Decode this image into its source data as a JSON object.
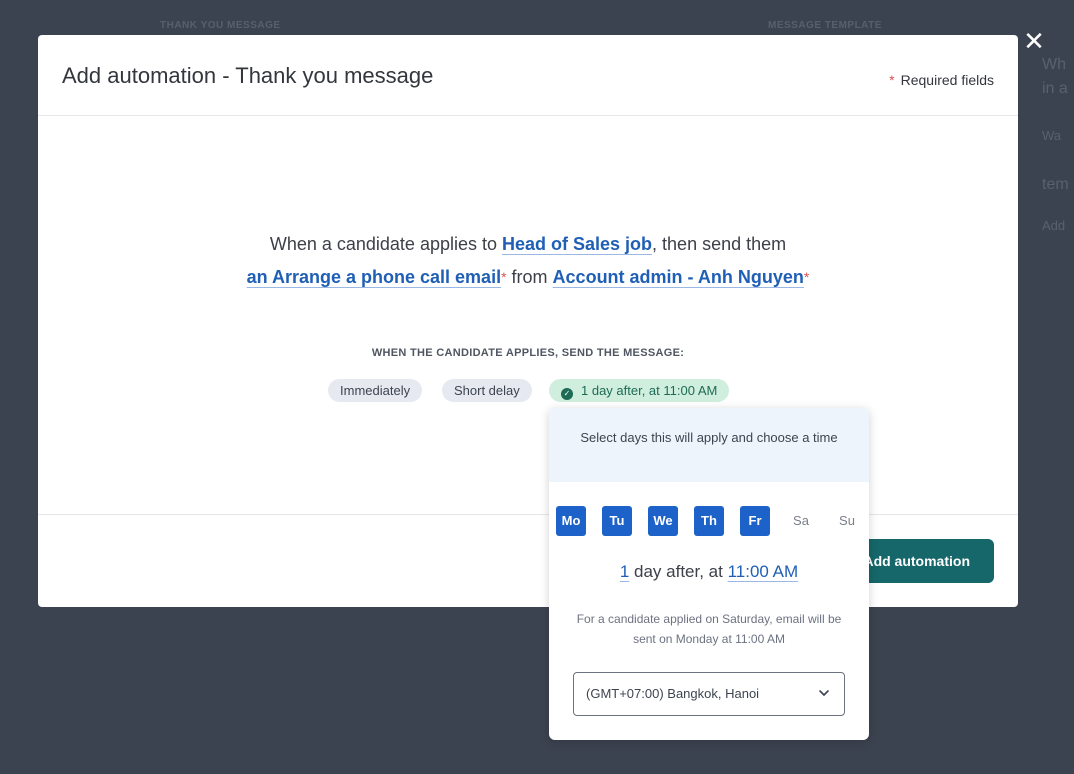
{
  "background": {
    "steps": [
      "Thank you message",
      "",
      "Message template"
    ],
    "side_text": [
      "Wh",
      "in a",
      "Wa",
      "tem",
      "Add"
    ]
  },
  "modal": {
    "title": "Add automation - Thank you message",
    "required_note": "Required fields",
    "sentence": {
      "part1": "When a candidate applies to ",
      "job_link": "Head of Sales job",
      "part2": ", then send them",
      "email_link": "an Arrange a phone call email",
      "part3": " from ",
      "sender_link": "Account admin - Anh Nguyen",
      "required_mark": "*"
    },
    "timing_label": "WHEN THE CANDIDATE APPLIES, SEND THE MESSAGE:",
    "timing_options": [
      {
        "label": "Immediately",
        "selected": false
      },
      {
        "label": "Short delay",
        "selected": false
      },
      {
        "label": "1 day after, at 11:00 AM",
        "selected": true
      }
    ],
    "submit_label": "Add automation"
  },
  "popover": {
    "header": "Select days this will apply and choose a time",
    "days": [
      {
        "label": "Mo",
        "selected": true
      },
      {
        "label": "Tu",
        "selected": true
      },
      {
        "label": "We",
        "selected": true
      },
      {
        "label": "Th",
        "selected": true
      },
      {
        "label": "Fr",
        "selected": true
      },
      {
        "label": "Sa",
        "selected": false
      },
      {
        "label": "Su",
        "selected": false
      }
    ],
    "delay_days": "1",
    "delay_text": " day after, at ",
    "delay_time": "11:00 AM",
    "note": "For a candidate applied on Saturday, email will be sent on Monday at 11:00 AM",
    "timezone": "(GMT+07:00) Bangkok, Hanoi"
  },
  "colors": {
    "accent": "#1d62c9",
    "primary_button": "#16676a",
    "selected_pill": "#cfeedd",
    "required": "#d9534f"
  }
}
